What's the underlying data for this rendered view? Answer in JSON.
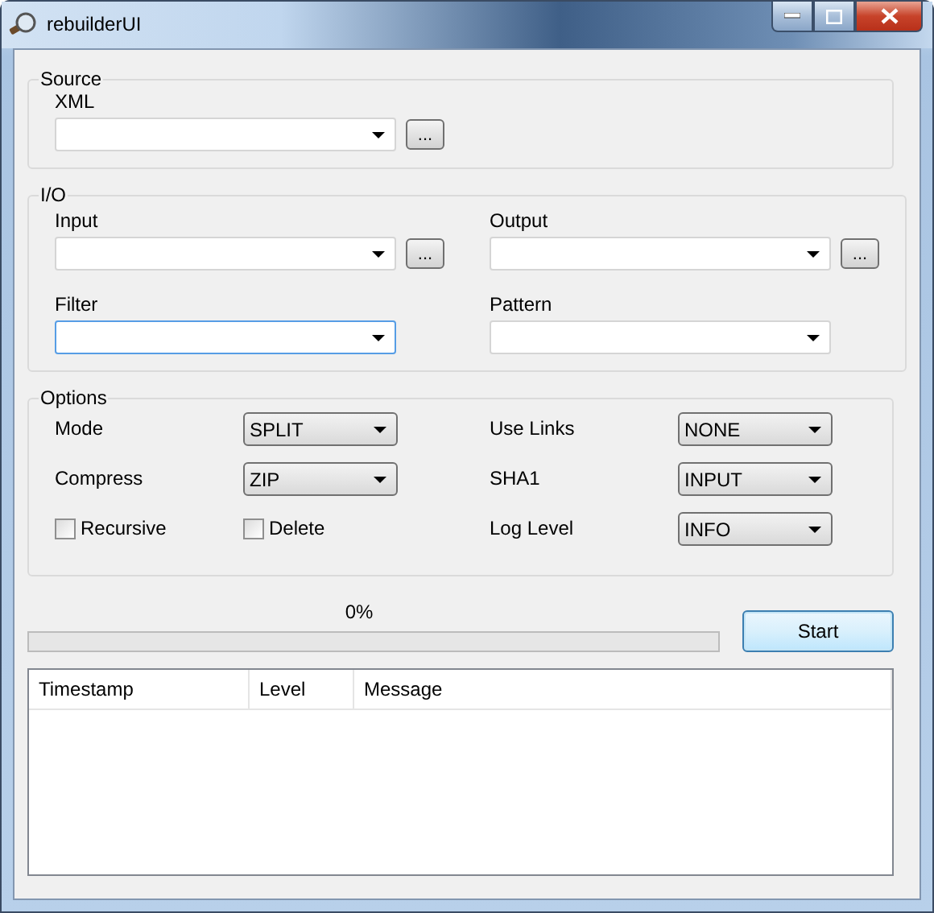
{
  "window": {
    "title": "rebuilderUI"
  },
  "source": {
    "legend": "Source",
    "fields": [
      {
        "label": "XML",
        "browse": "...",
        "focused": false
      }
    ]
  },
  "io": {
    "legend": "I/O",
    "fields": [
      {
        "label": "Input",
        "browse": "...",
        "focused": false
      },
      {
        "label": "Output",
        "browse": "...",
        "focused": false
      },
      {
        "label": "Filter",
        "focused": true
      },
      {
        "label": "Pattern",
        "focused": false
      }
    ]
  },
  "options": {
    "legend": "Options",
    "items": [
      {
        "kind": "select",
        "label": "Mode",
        "value": "SPLIT"
      },
      {
        "kind": "select",
        "label": "Use Links",
        "value": "NONE"
      },
      {
        "kind": "select",
        "label": "Compress",
        "value": "ZIP"
      },
      {
        "kind": "select",
        "label": "SHA1",
        "value": "INPUT"
      },
      {
        "kind": "checkbox",
        "label": "Recursive",
        "checked": false
      },
      {
        "kind": "checkbox",
        "label": "Delete",
        "checked": false
      },
      {
        "kind": "select",
        "label": "Log Level",
        "value": "INFO"
      }
    ]
  },
  "progress": {
    "label": "0%",
    "level": 0
  },
  "start_button": "Start",
  "log": {
    "columns": [
      "Timestamp",
      "Level",
      "Message"
    ]
  }
}
